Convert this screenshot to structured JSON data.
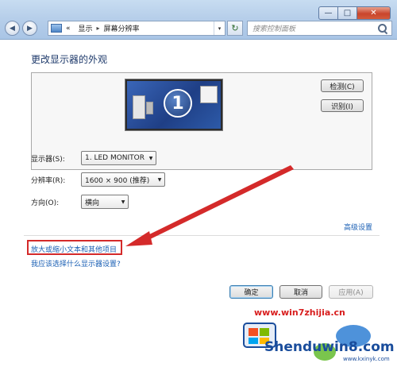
{
  "window": {
    "minimize_glyph": "—",
    "maximize_glyph": "□",
    "close_glyph": "✕"
  },
  "nav": {
    "back_glyph": "◀",
    "forward_glyph": "▶",
    "history_glyph": "▾"
  },
  "address": {
    "prefix": "«",
    "crumbs": [
      "显示",
      "屏幕分辨率"
    ],
    "separator": "▸",
    "dropdown_glyph": "▾",
    "refresh_glyph": "↻"
  },
  "search": {
    "placeholder": "搜索控制面板"
  },
  "main": {
    "title": "更改显示器的外观",
    "monitor_number": "1",
    "detect_button": "检测(C)",
    "identify_button": "识别(I)",
    "fields": {
      "display_label": "显示器(S):",
      "display_value": "1. LED MONITOR",
      "resolution_label": "分辨率(R):",
      "resolution_value": "1600 × 900 (推荐)",
      "orientation_label": "方向(O):",
      "orientation_value": "横向"
    },
    "advanced_link": "高级设置",
    "text_size_link": "放大或缩小文本和其他项目",
    "which_settings_link": "我应该选择什么显示器设置?"
  },
  "footer": {
    "ok_button": "确定",
    "cancel_button": "取消",
    "apply_button": "应用(A)"
  },
  "watermark": {
    "url": "www.win7zhijia.cn",
    "brand": "Shenduwin8.com",
    "site": "www.kxinyk.com"
  },
  "colors": {
    "link": "#1a5fb4",
    "highlight": "#d42a2a",
    "title_text": "#1e3a6b"
  }
}
